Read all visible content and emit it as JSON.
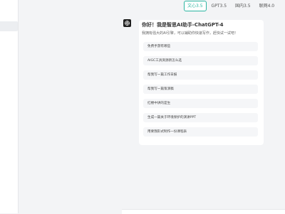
{
  "model_tabs": [
    "文心3.5",
    "GPT3.5",
    "国内3.5",
    "联网4.0"
  ],
  "active_tab": "文心3.5",
  "greeting": {
    "title": "你好！我是智思AI助手-ChatGPT-4",
    "subtitle": "我拥有强大的AI引擎，可以辅助你快速写作，赶快试一试吧！"
  },
  "suggestions": [
    "免费手游有哪些",
    "AIGC工具资源新怎么选",
    "帮我写一篇工作日报",
    "帮我写一篇策演稿",
    "红楼中讲的是生",
    "生成一篇关于环境保护的演讲PPT",
    "用要我形式制作一份课程表"
  ],
  "colors": {
    "accent": "#2bb5a1",
    "background": "#f3f4f6",
    "card": "#ffffff"
  }
}
